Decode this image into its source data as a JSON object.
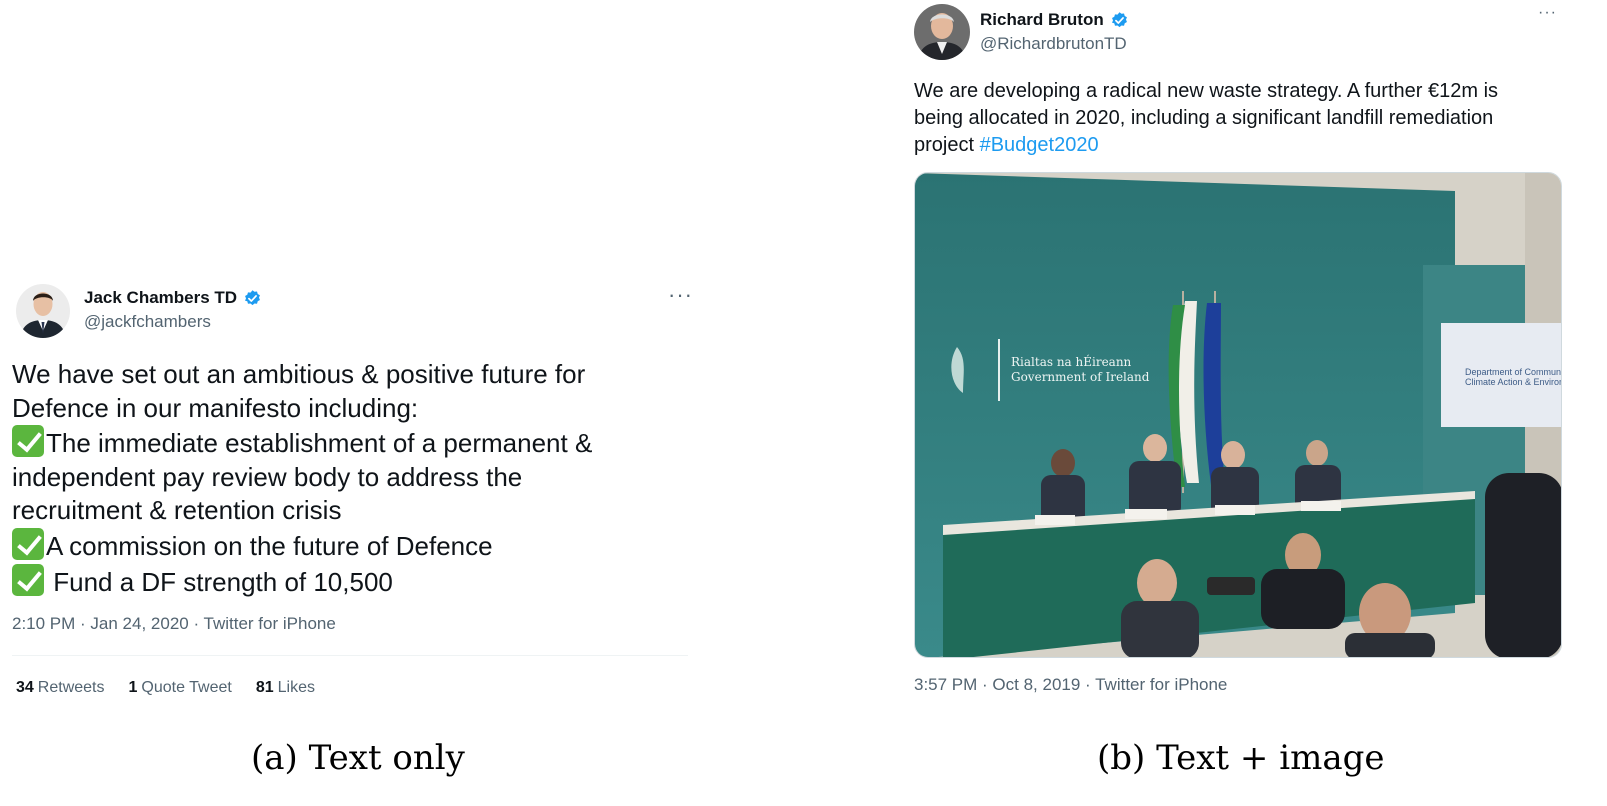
{
  "left_tweet": {
    "name": "Jack Chambers TD",
    "handle": "@jackfchambers",
    "more_icon": "more-horizontal-icon",
    "text_lines": [
      "We have set out an ambitious & positive future for",
      "Defence in our manifesto including:",
      "The immediate establishment of a permanent &",
      "independent pay review body to address the",
      "recruitment & retention crisis",
      "A commission on the future of Defence",
      " Fund a DF strength of 10,500"
    ],
    "meta": "2:10 PM · Jan 24, 2020 · Twitter for iPhone",
    "stats": {
      "retweets_count": "34",
      "retweets_label": "Retweets",
      "quotes_count": "1",
      "quotes_label": "Quote Tweet",
      "likes_count": "81",
      "likes_label": "Likes"
    }
  },
  "right_tweet": {
    "name": "Richard Bruton",
    "handle": "@RichardbrutonTD",
    "more_icon": "more-horizontal-icon",
    "text_lines": [
      "We are developing a radical new waste strategy. A further €12m is",
      "being allocated in 2020, including a significant landfill remediation",
      "project "
    ],
    "hashtag": "#Budget2020",
    "photo": {
      "wall_text_1": "Rialtas na hÉireann",
      "wall_text_2": "Government of Ireland",
      "screen_text_1": "Department of Communica",
      "screen_text_2": "Climate Action & Environm"
    },
    "meta": "3:57 PM · Oct 8, 2019 · Twitter for iPhone"
  },
  "captions": {
    "a": "(a) Text only",
    "b": "(b) Text + image"
  },
  "colors": {
    "verified": "#1d9bf0",
    "hashtag": "#1d9bf0",
    "check_emoji": "#5bb63e",
    "backdrop": "#2f7f80"
  }
}
